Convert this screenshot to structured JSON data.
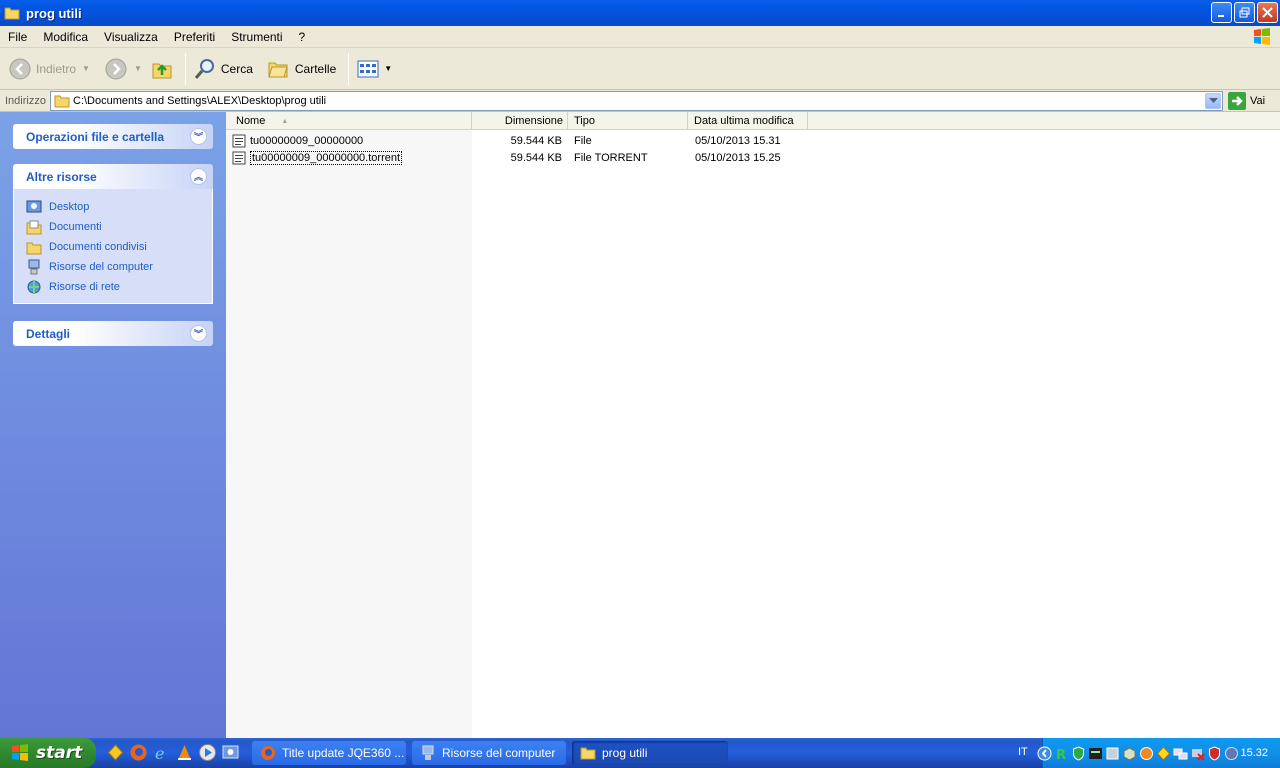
{
  "window": {
    "title": "prog utili"
  },
  "menu": [
    "File",
    "Modifica",
    "Visualizza",
    "Preferiti",
    "Strumenti",
    "?"
  ],
  "toolbar": {
    "back": "Indietro",
    "search": "Cerca",
    "folders": "Cartelle"
  },
  "address": {
    "label": "Indirizzo",
    "path": "C:\\Documents and Settings\\ALEX\\Desktop\\prog utili",
    "go": "Vai"
  },
  "sidebar": {
    "tasks_title": "Operazioni file e cartella",
    "other_title": "Altre risorse",
    "other_links": [
      "Desktop",
      "Documenti",
      "Documenti condivisi",
      "Risorse del computer",
      "Risorse di rete"
    ],
    "details_title": "Dettagli"
  },
  "columns": {
    "name": "Nome",
    "size": "Dimensione",
    "type": "Tipo",
    "modified": "Data ultima modifica"
  },
  "files": [
    {
      "name": "tu00000009_00000000",
      "size": "59.544 KB",
      "type": "File",
      "modified": "05/10/2013 15.31"
    },
    {
      "name": "tu00000009_00000000.torrent",
      "size": "59.544 KB",
      "type": "File TORRENT",
      "modified": "05/10/2013 15.25"
    }
  ],
  "taskbar": {
    "start": "start",
    "tasks": [
      "Title update JQE360 ...",
      "Risorse del computer",
      "prog utili"
    ],
    "language": "IT",
    "clock": "15.32"
  }
}
